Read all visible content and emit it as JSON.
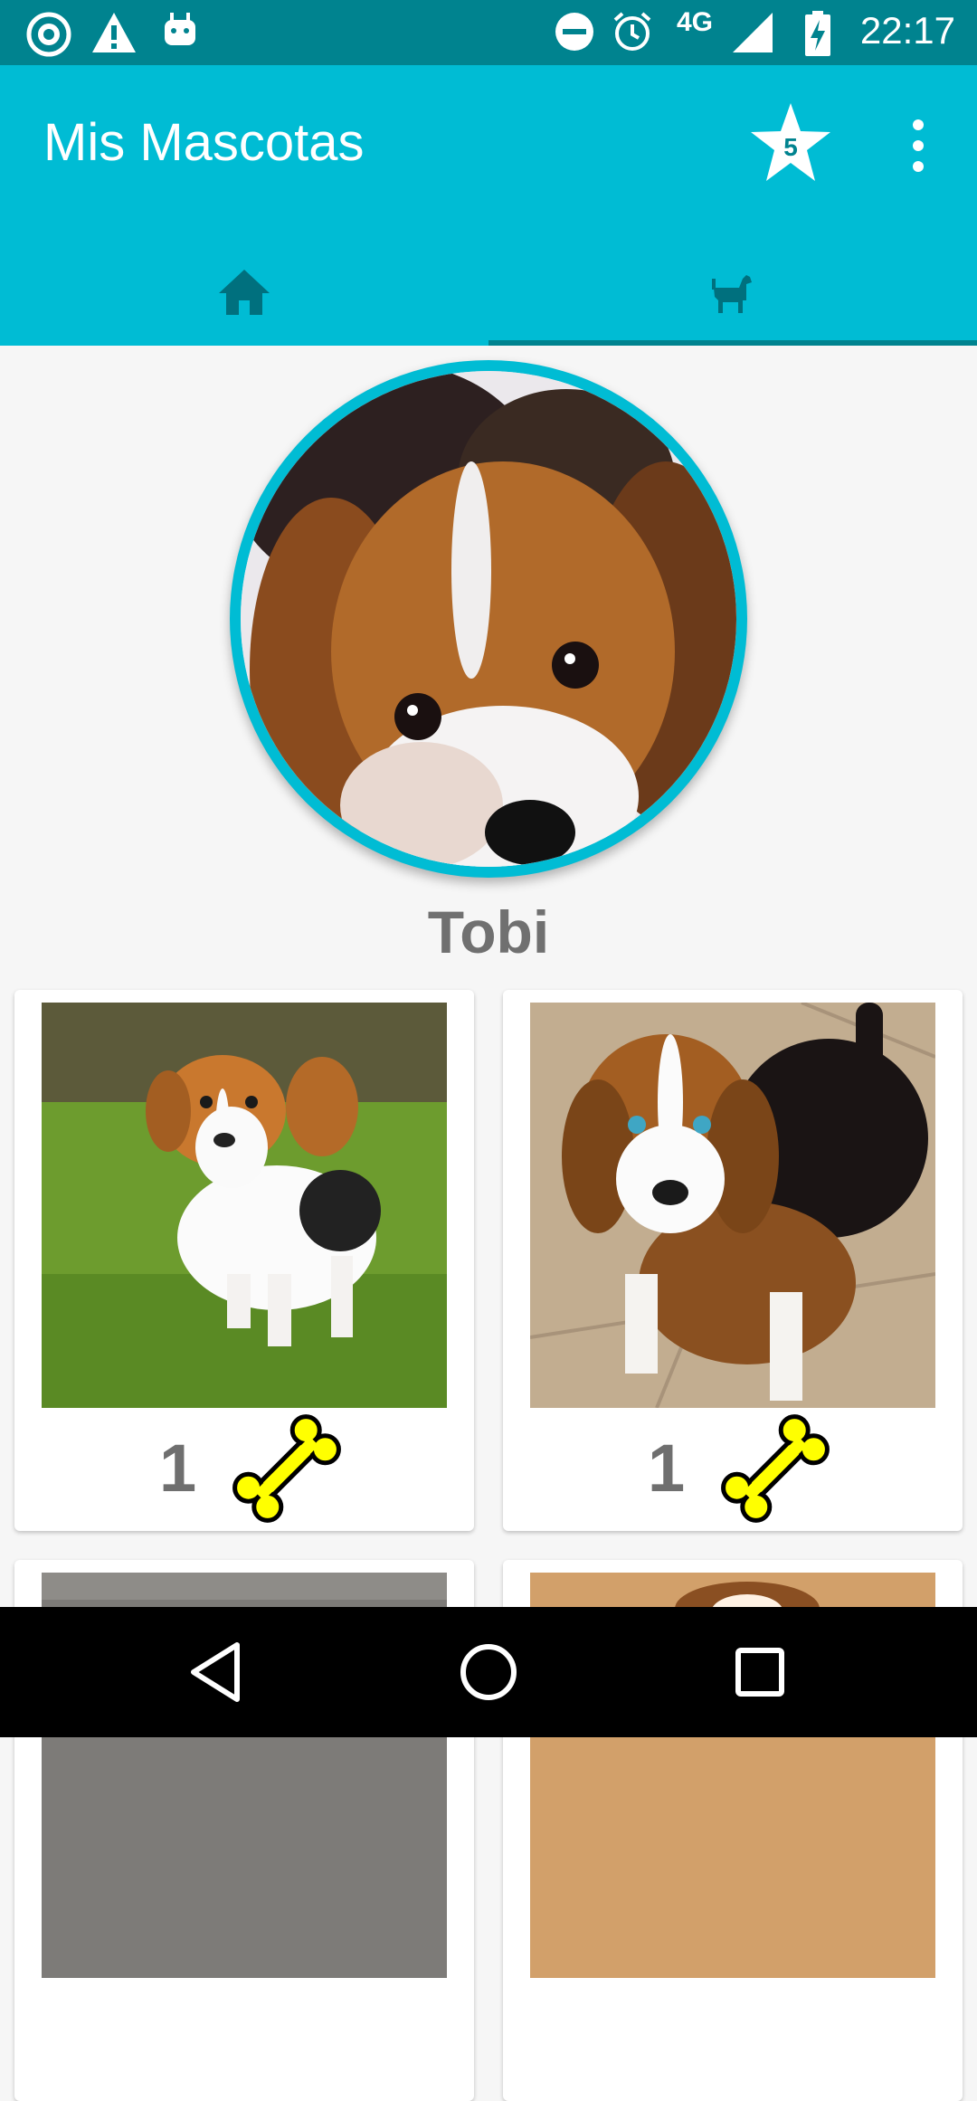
{
  "status_bar": {
    "time": "22:17",
    "network": "4G",
    "icons": [
      "ssh-icon",
      "warning-icon",
      "android-icon",
      "dnd-icon",
      "alarm-icon",
      "signal-icon",
      "battery-charging-icon"
    ]
  },
  "app_bar": {
    "title": "Mis Mascotas",
    "rating_badge": "5",
    "menu_icon": "more-vert-icon"
  },
  "tabs": [
    {
      "icon": "home-icon",
      "selected": false
    },
    {
      "icon": "dog-icon",
      "selected": true
    }
  ],
  "profile": {
    "name": "Tobi"
  },
  "photos": [
    {
      "likes": "1",
      "icon": "bone-icon"
    },
    {
      "likes": "1",
      "icon": "bone-icon"
    },
    {
      "likes": "",
      "icon": ""
    },
    {
      "likes": "",
      "icon": ""
    }
  ],
  "colors": {
    "primary": "#00bcd4",
    "primary_dark": "#00838f",
    "bone": "#ffff00"
  },
  "nav_bar": {
    "buttons": [
      "back-icon",
      "home-circle-icon",
      "recents-icon"
    ]
  }
}
